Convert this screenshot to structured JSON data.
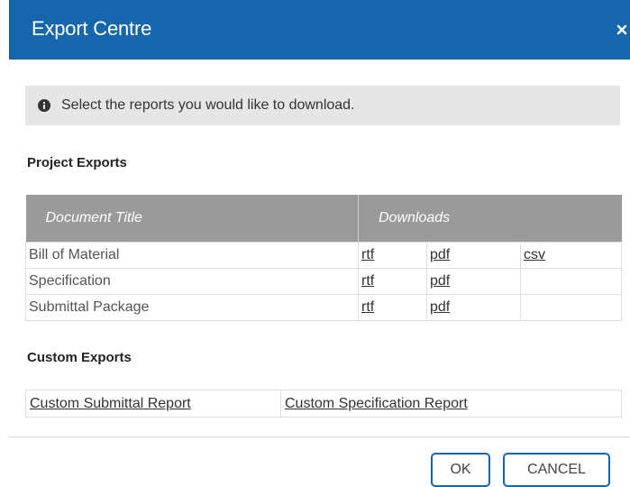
{
  "dialog": {
    "title": "Export Centre",
    "close_icon": "close-icon",
    "accent_color": "#1566ad"
  },
  "info": {
    "icon": "info-icon",
    "message": "Select the reports you would like to download."
  },
  "project_exports": {
    "heading": "Project Exports",
    "columns": [
      "Document Title",
      "Downloads"
    ],
    "rows": [
      {
        "title": "Bill of Material",
        "rtf": "rtf",
        "pdf": "pdf",
        "csv": "csv"
      },
      {
        "title": "Specification",
        "rtf": "rtf",
        "pdf": "pdf",
        "csv": ""
      },
      {
        "title": "Submittal Package",
        "rtf": "rtf",
        "pdf": "pdf",
        "csv": ""
      }
    ]
  },
  "custom_exports": {
    "heading": "Custom Exports",
    "links": [
      "Custom Submittal Report",
      "Custom Specification Report"
    ]
  },
  "buttons": {
    "ok": "OK",
    "cancel": "CANCEL"
  }
}
